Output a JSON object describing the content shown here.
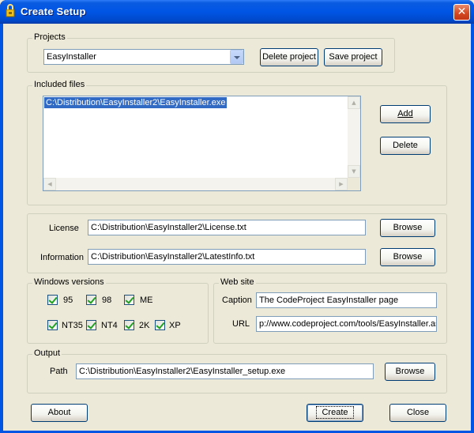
{
  "window": {
    "title": "Create Setup",
    "close_glyph": "✕"
  },
  "projects": {
    "group_label": "Projects",
    "selected": "EasyInstaller",
    "delete_label": "Delete project",
    "save_label": "Save project"
  },
  "included_files": {
    "group_label": "Included files",
    "files": [
      "C:\\Distribution\\EasyInstaller2\\EasyInstaller.exe"
    ],
    "add_label": "Add",
    "delete_label": "Delete"
  },
  "license": {
    "label": "License",
    "value": "C:\\Distribution\\EasyInstaller2\\License.txt",
    "browse_label": "Browse"
  },
  "information": {
    "label": "Information",
    "value": "C:\\Distribution\\EasyInstaller2\\LatestInfo.txt",
    "browse_label": "Browse"
  },
  "windows_versions": {
    "group_label": "Windows versions",
    "options": [
      {
        "label": "95",
        "checked": true
      },
      {
        "label": "98",
        "checked": true
      },
      {
        "label": "ME",
        "checked": true
      },
      {
        "label": "NT35",
        "checked": true
      },
      {
        "label": "NT4",
        "checked": true
      },
      {
        "label": "2K",
        "checked": true
      },
      {
        "label": "XP",
        "checked": true
      }
    ]
  },
  "website": {
    "group_label": "Web site",
    "caption_label": "Caption",
    "caption_value": "The CodeProject EasyInstaller page",
    "url_label": "URL",
    "url_value": "p://www.codeproject.com/tools/EasyInstaller.asp"
  },
  "output": {
    "group_label": "Output",
    "path_label": "Path",
    "path_value": "C:\\Distribution\\EasyInstaller2\\EasyInstaller_setup.exe",
    "browse_label": "Browse"
  },
  "footer": {
    "about_label": "About",
    "create_label": "Create",
    "close_label": "Close"
  },
  "colors": {
    "title_bar": "#0055e5",
    "selection": "#316ac5",
    "dialog_bg": "#ece9d8"
  }
}
